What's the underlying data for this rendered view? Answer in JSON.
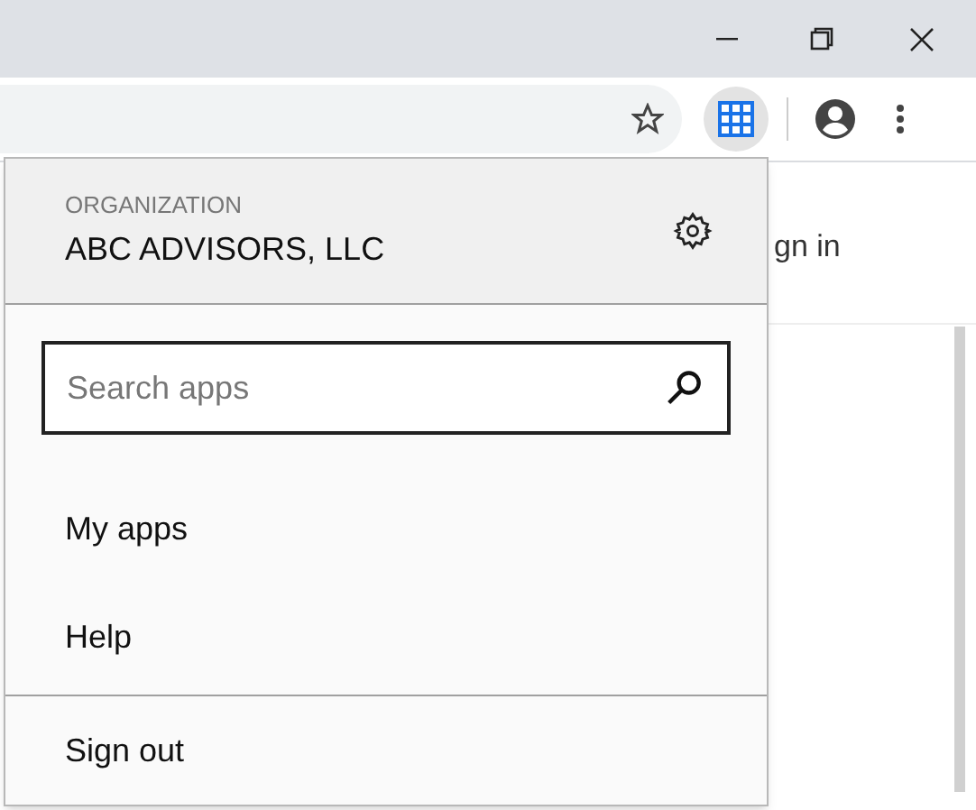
{
  "toolbar": {
    "apps_button": {
      "pressed": true
    }
  },
  "page": {
    "sign_in_fragment": "gn in"
  },
  "popup": {
    "org_label": "ORGANIZATION",
    "org_name": "ABC ADVISORS, LLC",
    "search": {
      "placeholder": "Search apps"
    },
    "items": [
      "My apps",
      "Help"
    ],
    "footer_items": [
      "Sign out"
    ]
  }
}
